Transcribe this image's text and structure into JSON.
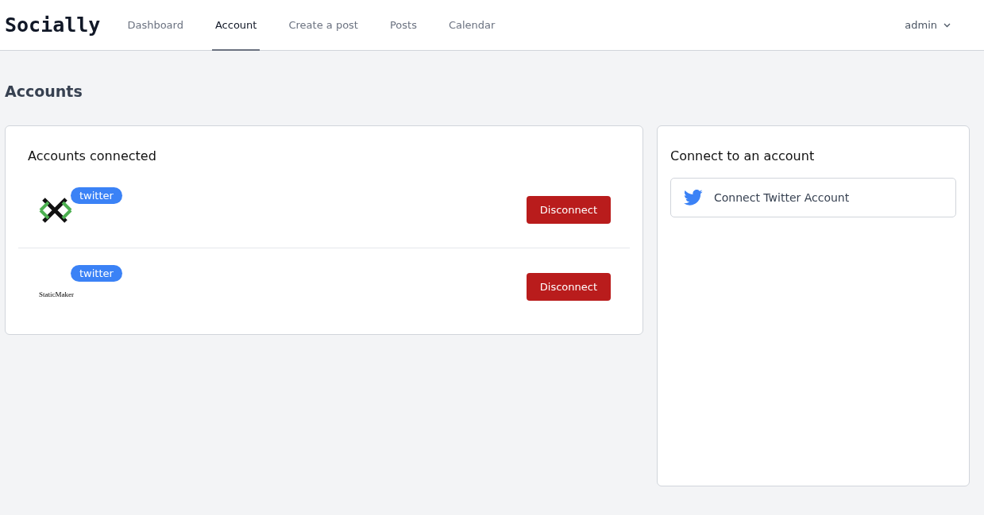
{
  "brand": "Socially",
  "nav": [
    {
      "label": "Dashboard",
      "selected": false
    },
    {
      "label": "Account",
      "selected": true
    },
    {
      "label": "Create a post",
      "selected": false
    },
    {
      "label": "Posts",
      "selected": false
    },
    {
      "label": "Calendar",
      "selected": false
    }
  ],
  "user_menu": {
    "label": "admin"
  },
  "page_title": "Accounts",
  "connected": {
    "title": "Accounts connected",
    "accounts": [
      {
        "kind": "cross",
        "badge": "twitter",
        "button": "Disconnect"
      },
      {
        "kind": "wordmark",
        "logo_text": "StaticMaker",
        "badge": "twitter",
        "button": "Disconnect"
      }
    ]
  },
  "connect": {
    "title": "Connect to an account",
    "button": "Connect Twitter Account"
  }
}
